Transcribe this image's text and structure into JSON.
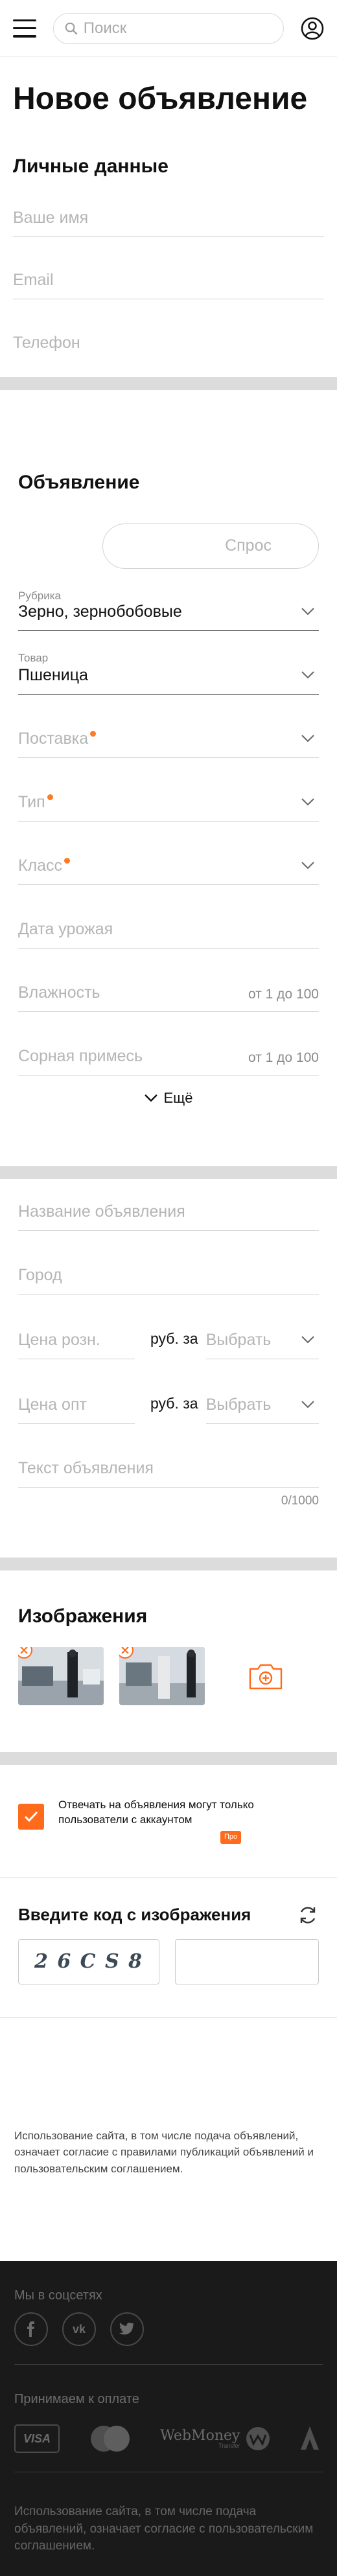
{
  "header": {
    "search_placeholder": "Поиск"
  },
  "page": {
    "title": "Новое объявление"
  },
  "personal": {
    "title": "Личные данные",
    "name_placeholder": "Ваше имя",
    "email_placeholder": "Email",
    "phone_placeholder": "Телефон"
  },
  "ad": {
    "title": "Объявление",
    "toggle_label": "Спрос",
    "rubric_label": "Рубрика",
    "rubric_value": "Зерно, зернобобовые",
    "product_label": "Товар",
    "product_value": "Пшеница",
    "supply_placeholder": "Поставка",
    "type_placeholder": "Тип",
    "class_placeholder": "Класс",
    "harvest_placeholder": "Дата урожая",
    "humidity_placeholder": "Влажность",
    "humidity_hint": "от 1 до 100",
    "weed_placeholder": "Сорная примесь",
    "weed_hint": "от 1 до 100",
    "more_label": "Ещё"
  },
  "details": {
    "name_placeholder": "Название объявления",
    "city_placeholder": "Город",
    "retail_placeholder": "Цена розн.",
    "retail_unit": "руб. за",
    "retail_select": "Выбрать",
    "wholesale_placeholder": "Цена опт",
    "wholesale_unit": "руб. за",
    "wholesale_select": "Выбрать",
    "text_placeholder": "Текст объявления",
    "text_counter": "0/1000"
  },
  "images": {
    "title": "Изображения",
    "count": 2
  },
  "consent": {
    "text": "Отвечать на объявления могут только пользователи с аккаунтом",
    "tag": "Про"
  },
  "captcha": {
    "title": "Введите код с изображения",
    "code_text": "2 6 C S 8"
  },
  "terms": {
    "text": "Использование сайта, в том числе подача объявлений, означает согласие с правилами публикаций объявлений и пользовательским соглашением."
  },
  "footer": {
    "social_title": "Мы в соцсетях",
    "payment_title": "Принимаем к оплате",
    "visa_label": "VISA",
    "webmoney_label": "WebMoney",
    "webmoney_sub": "Transfer",
    "bottom_text": "Использование сайта, в том числе подача объявлений, означает согласие с пользовательским соглашением."
  },
  "colors": {
    "accent": "#ff6b1a",
    "dark_footer": "#1a1a1a",
    "divider": "#dcdcdc"
  }
}
